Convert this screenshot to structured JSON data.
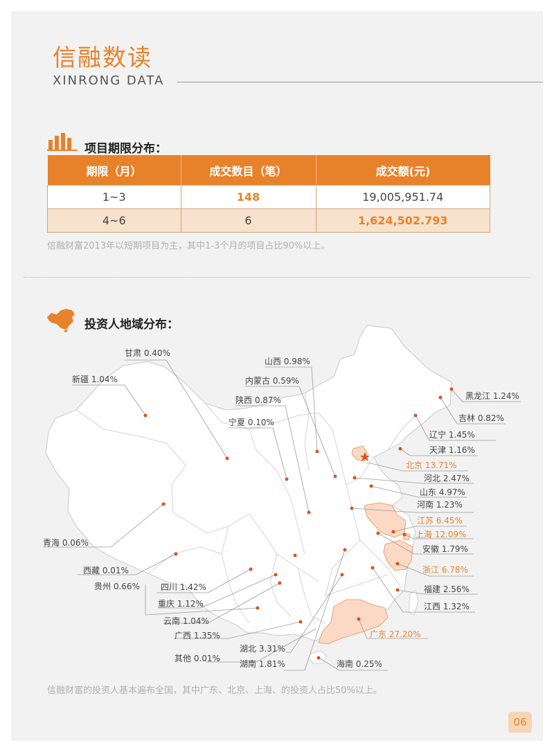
{
  "header": {
    "title": "信融数读",
    "subtitle": "XINRONG DATA"
  },
  "section1": {
    "title": "项目期限分布：",
    "columns": [
      "期限（月）",
      "成交数目（笔）",
      "成交额(元)"
    ],
    "rows": [
      [
        "1~3",
        "148",
        "19,005,951.74"
      ],
      [
        "4~6",
        "6",
        "1,624,502.793"
      ]
    ],
    "note": "信融财富2013年以短期项目为主，其中1-3个月的项目占比90%以上。"
  },
  "section2": {
    "title": "投资人地域分布：",
    "regions": [
      "甘肃 0.40%",
      "新疆 1.04%",
      "山西 0.98%",
      "内蒙古 0.59%",
      "陕西 0.87%",
      "宁夏 0.10%",
      "黑龙江 1.24%",
      "吉林 0.82%",
      "辽宁 1.45%",
      "天津 1.16%",
      "北京 13.71%",
      "河北 2.47%",
      "山东 4.97%",
      "河南 1.23%",
      "江苏  6.45%",
      "上海  12.09%",
      "安徽 1.79%",
      "浙江  6.78%",
      "福建  2.56%",
      "江西 1.32%",
      "广东  27.20%",
      "海南  0.25%",
      "湖南 1.81%",
      "湖北 3.31%",
      "其他  0.01%",
      "广西 1.35%",
      "云南 1.04%",
      "重庆 1.12%",
      "四川 1.42%",
      "贵州 0.66%",
      "西藏  0.01%",
      "青海  0.06%"
    ],
    "note": "信融财富的投资人基本遍布全国，其中广东、北京、上海、的投资人占比50%以上。"
  },
  "page_number": "06",
  "colors": {
    "accent": "#e8822a",
    "highlight_region": "#fbd9c4",
    "page_bg": "#f2f2f2"
  }
}
